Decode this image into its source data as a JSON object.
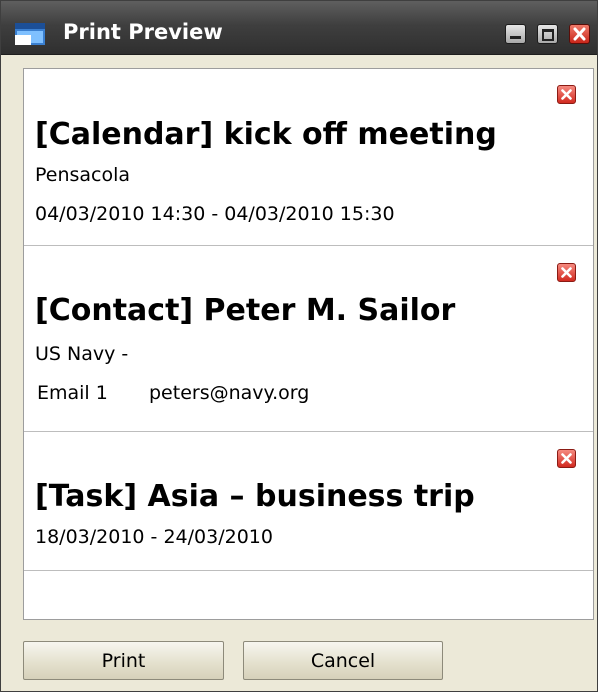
{
  "window": {
    "title": "Print Preview",
    "icon": "window-app-icon",
    "controls": [
      "minimize-icon",
      "maximize-icon",
      "close-icon"
    ]
  },
  "items": [
    {
      "title": "[Calendar] kick off meeting",
      "line1": "Pensacola",
      "line2": "04/03/2010 14:30 - 04/03/2010 15:30"
    },
    {
      "title": "[Contact] Peter M. Sailor",
      "line1": "US Navy -",
      "email_label": "Email 1",
      "email_value": "peters@navy.org"
    },
    {
      "title": "[Task] Asia – business trip",
      "line1": "18/03/2010 - 24/03/2010"
    }
  ],
  "buttons": {
    "print": "Print",
    "cancel": "Cancel"
  },
  "colors": {
    "titlebar": "#3f3f3f",
    "window_bg": "#ece9d8",
    "delete_red": "#d22a20"
  }
}
